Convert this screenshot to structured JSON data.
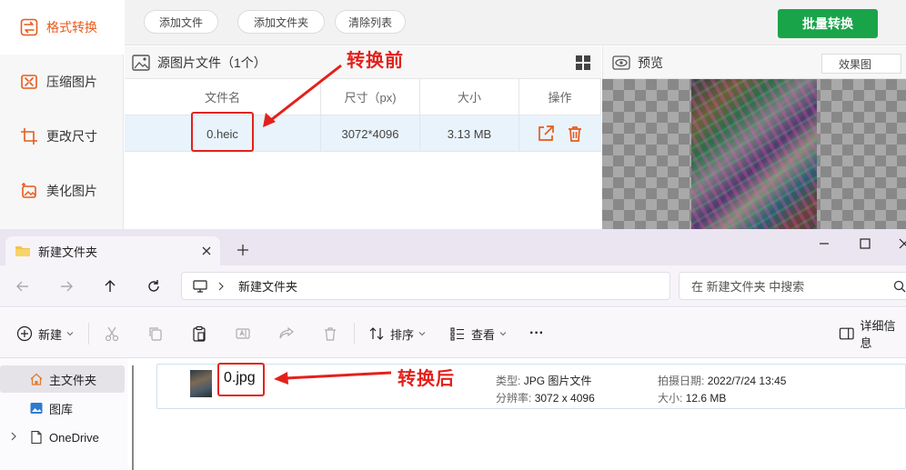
{
  "converter": {
    "sidebar": [
      {
        "label": "格式转换",
        "icon": "swap-icon",
        "active": true
      },
      {
        "label": "压缩图片",
        "icon": "compress-icon",
        "active": false
      },
      {
        "label": "更改尺寸",
        "icon": "crop-icon",
        "active": false
      },
      {
        "label": "美化图片",
        "icon": "sparkle-image-icon",
        "active": false
      }
    ],
    "toolbar": {
      "add_file": "添加文件",
      "add_folder": "添加文件夹",
      "clear_list": "清除列表",
      "batch_convert": "批量转换"
    },
    "source_panel": {
      "title": "源图片文件（1个）",
      "columns": [
        "文件名",
        "尺寸（px)",
        "大小",
        "操作"
      ],
      "rows": [
        {
          "name": "0.heic",
          "dimensions": "3072*4096",
          "size": "3.13 MB"
        }
      ]
    },
    "preview": {
      "title": "预览",
      "mode": "效果图"
    },
    "colors": {
      "accent": "#e85a1b",
      "batch_button": "#1aa44a",
      "row_selected": "#e9f3fb"
    }
  },
  "explorer": {
    "tab_title": "新建文件夹",
    "address_path": "新建文件夹",
    "search_placeholder": "在 新建文件夹 中搜索",
    "commands": {
      "new": "新建",
      "sort": "排序",
      "view": "查看",
      "more": "···",
      "details": "详细信息"
    },
    "nav": [
      {
        "label": "主文件夹",
        "icon": "home-icon",
        "selected": true
      },
      {
        "label": "图库",
        "icon": "gallery-icon",
        "selected": false
      },
      {
        "label": "OneDrive",
        "icon": "document-icon",
        "selected": false
      }
    ],
    "file": {
      "name": "0.jpg",
      "type_label": "类型:",
      "type_value": "JPG 图片文件",
      "resolution_label": "分辨率:",
      "resolution_value": "3072 x 4096",
      "date_label": "拍摄日期:",
      "date_value": "2022/7/24 13:45",
      "size_label": "大小:",
      "size_value": "12.6 MB"
    }
  },
  "annotations": {
    "before": "转换前",
    "after": "转换后",
    "color": "#e3211b"
  }
}
